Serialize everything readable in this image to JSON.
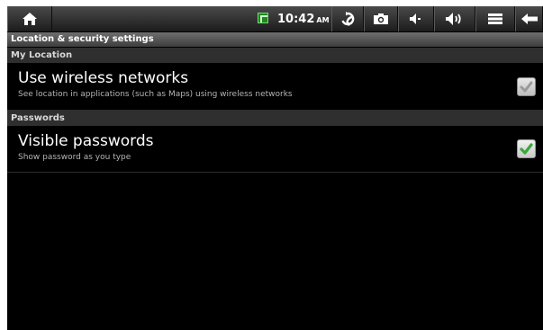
{
  "status_bar": {
    "time": "10:42",
    "ampm": "AM",
    "icons": [
      "home-icon",
      "battery-icon",
      "refresh-icon",
      "camera-icon",
      "volume-down-icon",
      "volume-up-icon",
      "menu-icon",
      "back-icon"
    ]
  },
  "screen": {
    "title": "Location & security settings",
    "sections": [
      {
        "header": "My Location",
        "item": {
          "title": "Use wireless networks",
          "summary": "See location in applications (such as Maps) using wireless networks",
          "checked": true,
          "enabled": false
        }
      },
      {
        "header": "Passwords",
        "item": {
          "title": "Visible passwords",
          "summary": "Show password as you type",
          "checked": true,
          "enabled": true
        }
      }
    ]
  },
  "colors": {
    "check_green": "#3aa83a",
    "check_disabled": "#9a9a9a"
  }
}
